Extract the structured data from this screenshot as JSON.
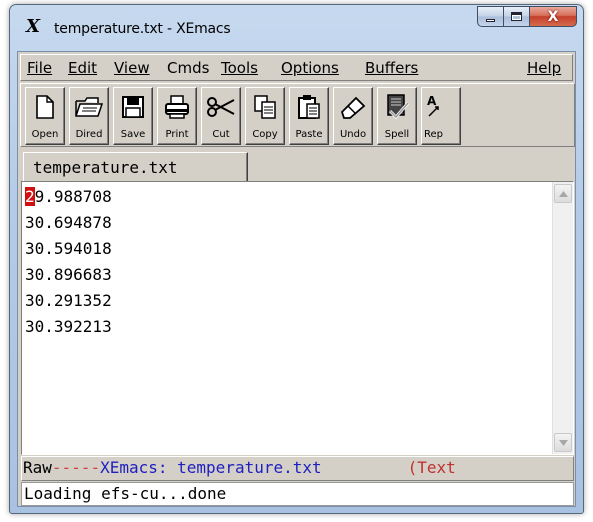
{
  "window": {
    "title": "temperature.txt - XEmacs",
    "app_icon": "x-logo-icon",
    "app_icon_glyph": "X",
    "close_glyph": "X"
  },
  "menubar": {
    "file": "File",
    "edit": "Edit",
    "view": "View",
    "cmds": "Cmds",
    "tools": "Tools",
    "options": "Options",
    "buffers": "Buffers",
    "help": "Help"
  },
  "toolbar": {
    "open": "Open",
    "dired": "Dired",
    "save": "Save",
    "print": "Print",
    "cut": "Cut",
    "copy": "Copy",
    "paste": "Paste",
    "undo": "Undo",
    "spell": "Spell",
    "replace": "Rep"
  },
  "tab": {
    "label": "temperature.txt"
  },
  "buffer": {
    "cursor_char": "2",
    "first_rest": "9.988708",
    "lines": [
      "30.694878",
      "30.594018",
      "30.896683",
      "30.291352",
      "30.392213"
    ]
  },
  "modeline": {
    "raw": "Raw",
    "dashes": "-----",
    "buffer_id": "XEmacs: temperature.txt",
    "mode": "(Text"
  },
  "minibuffer": {
    "message": "Loading efs-cu...done"
  },
  "colors": {
    "cursor": "#d01010",
    "modeline_buffer": "#2020c0",
    "modeline_mode": "#c03030"
  }
}
